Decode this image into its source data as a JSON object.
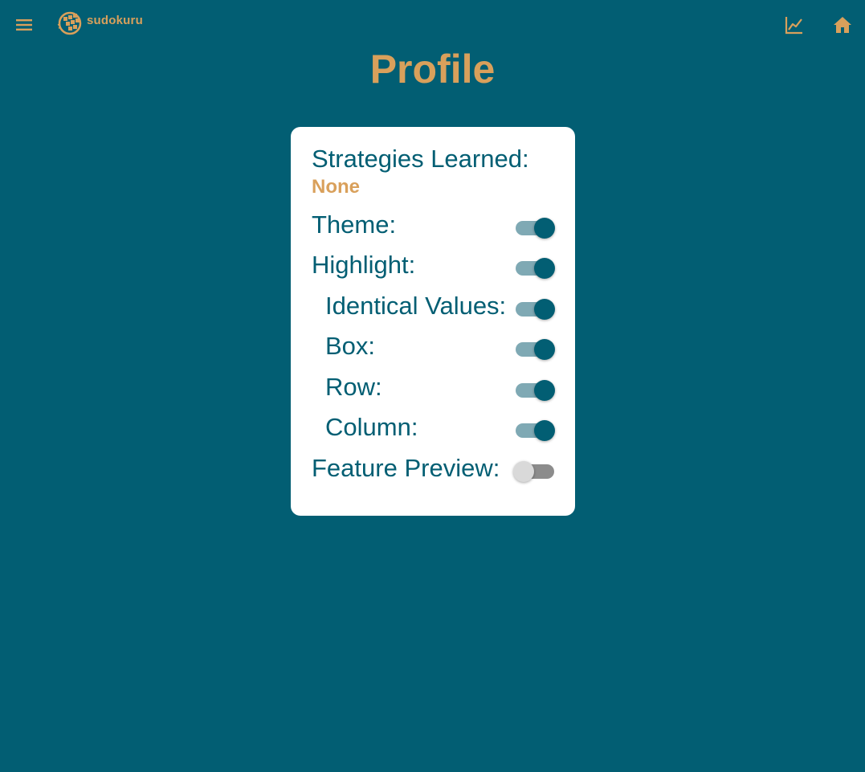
{
  "app": {
    "logo_text": "sudokuru"
  },
  "page": {
    "title": "Profile"
  },
  "profile": {
    "strategies_label": "Strategies Learned:",
    "strategies_value": "None",
    "settings": [
      {
        "label": "Theme:",
        "enabled": true,
        "indent": false
      },
      {
        "label": "Highlight:",
        "enabled": true,
        "indent": false
      },
      {
        "label": "Identical Values:",
        "enabled": true,
        "indent": true
      },
      {
        "label": "Box:",
        "enabled": true,
        "indent": true
      },
      {
        "label": "Row:",
        "enabled": true,
        "indent": true
      },
      {
        "label": "Column:",
        "enabled": true,
        "indent": true
      },
      {
        "label": "Feature Preview:",
        "enabled": false,
        "indent": false
      }
    ]
  },
  "icons": {
    "menu": "menu-icon",
    "statistics": "chart-line-icon",
    "home": "home-icon"
  },
  "colors": {
    "background": "#025e73",
    "accent": "#d9a05b",
    "card": "#ffffff",
    "toggle_on_thumb": "#025e73",
    "toggle_on_track": "#7fa9b4",
    "toggle_off_thumb": "#d9d9d9",
    "toggle_off_track": "#8c8c8c"
  }
}
